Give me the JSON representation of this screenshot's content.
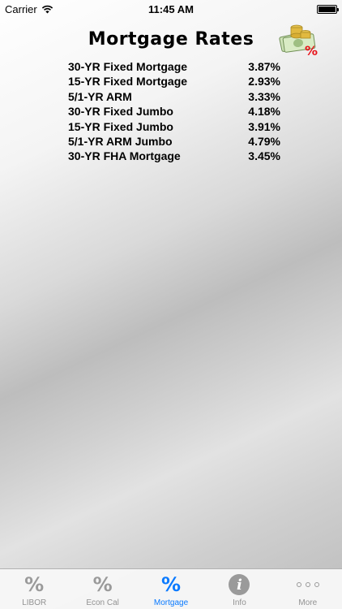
{
  "status": {
    "carrier": "Carrier",
    "time": "11:45 AM"
  },
  "title": "Mortgage Rates",
  "rates": [
    {
      "name": "30-YR Fixed Mortgage",
      "value": "3.87%"
    },
    {
      "name": "15-YR Fixed Mortgage",
      "value": "2.93%"
    },
    {
      "name": "5/1-YR ARM",
      "value": "3.33%"
    },
    {
      "name": "30-YR Fixed Jumbo",
      "value": "4.18%"
    },
    {
      "name": "15-YR Fixed Jumbo",
      "value": "3.91%"
    },
    {
      "name": "5/1-YR ARM Jumbo",
      "value": "4.79%"
    },
    {
      "name": "30-YR FHA Mortgage",
      "value": "3.45%"
    }
  ],
  "tabs": [
    {
      "label": "LIBOR",
      "icon": "percent-icon",
      "glyph": "%"
    },
    {
      "label": "Econ Cal",
      "icon": "percent-icon",
      "glyph": "%"
    },
    {
      "label": "Mortgage",
      "icon": "percent-icon",
      "glyph": "%",
      "active": true
    },
    {
      "label": "Info",
      "icon": "info-icon",
      "glyph": "i"
    },
    {
      "label": "More",
      "icon": "more-icon",
      "glyph": ""
    }
  ],
  "colors": {
    "accent": "#0a7aff",
    "inactive": "#929292",
    "logo_percent": "#e8141b"
  }
}
